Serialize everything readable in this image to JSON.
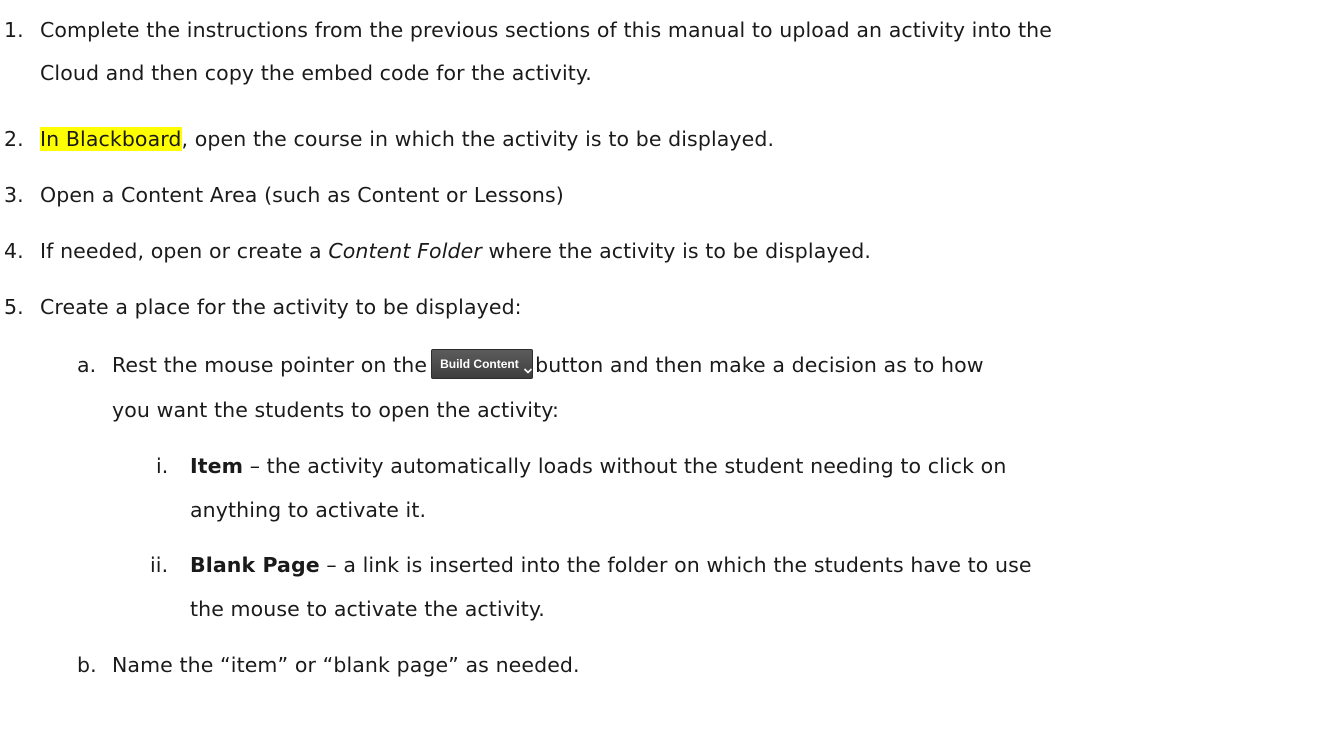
{
  "steps": [
    {
      "number": "1.",
      "line1": "Complete the instructions from the previous sections of this manual to upload an activity into the",
      "line2": "Cloud and then copy the embed code for the activity."
    },
    {
      "number": "2.",
      "highlight": "In Blackboard",
      "rest": ", open the course in which the activity is to be displayed."
    },
    {
      "number": "3.",
      "text": "Open a Content Area (such as Content or Lessons)"
    },
    {
      "number": "4.",
      "before": "If needed, open or create a ",
      "italic": "Content Folder",
      "after": " where the activity is to be displayed."
    },
    {
      "number": "5.",
      "text": "Create a place for the activity to be displayed:"
    }
  ],
  "substeps": {
    "a": {
      "letter": "a.",
      "before": "Rest the mouse pointer on the",
      "after": "button and then make a decision as to how",
      "line2": "you want the students to open the activity:"
    },
    "b": {
      "letter": "b.",
      "text": "Name the “item” or “blank page” as needed."
    }
  },
  "build_button": {
    "label": "Build Content",
    "icon": "chevron-down-icon",
    "bg": "#4a4a4a"
  },
  "options": [
    {
      "numeral": "i.",
      "term": "Item",
      "desc": " – the activity automatically loads without the student needing to click on",
      "desc2": "anything to activate it."
    },
    {
      "numeral": "ii.",
      "term": "Blank Page",
      "desc": " – a link is inserted into the folder on which the students have to use",
      "desc2": "the mouse to activate the activity."
    }
  ],
  "colors": {
    "highlight": "#ffff00",
    "text": "#1a1a1a"
  }
}
